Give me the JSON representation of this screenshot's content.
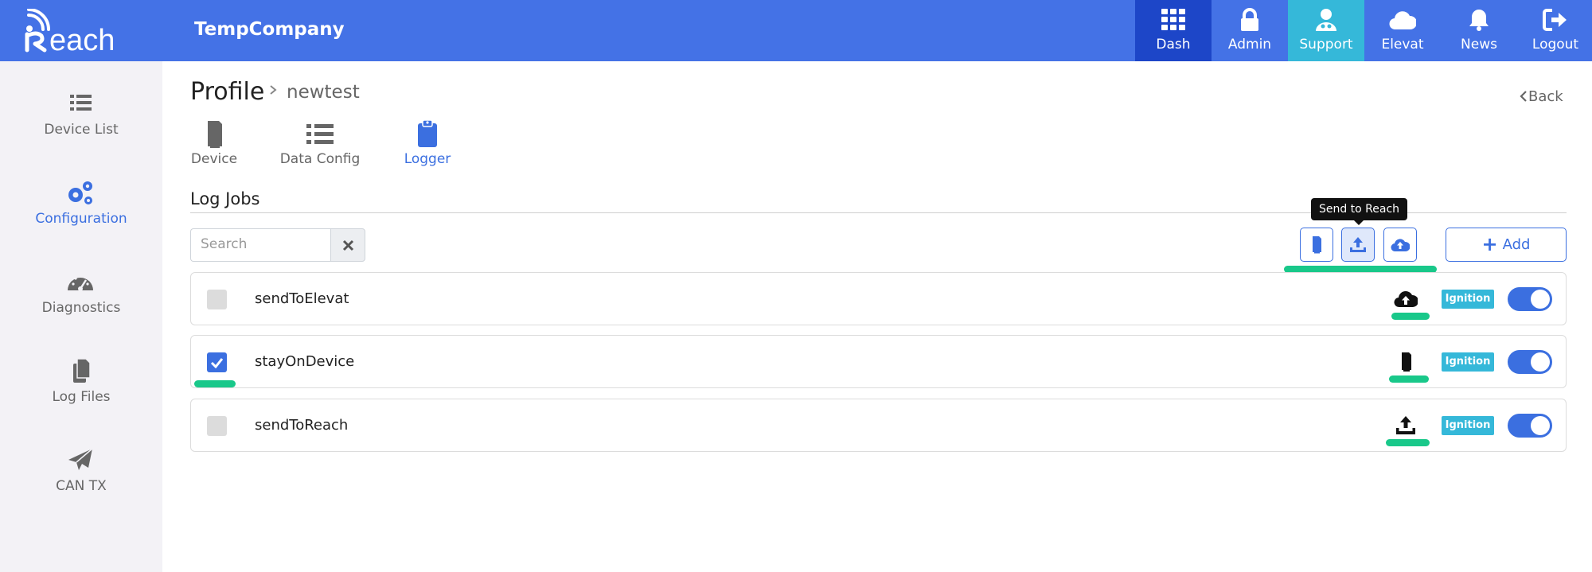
{
  "header": {
    "company": "TempCompany",
    "nav": [
      {
        "label": "Dash",
        "icon": "grid-icon"
      },
      {
        "label": "Admin",
        "icon": "lock-icon"
      },
      {
        "label": "Support",
        "icon": "support-user-icon"
      },
      {
        "label": "Elevat",
        "icon": "cloud-icon"
      },
      {
        "label": "News",
        "icon": "bell-icon"
      },
      {
        "label": "Logout",
        "icon": "logout-icon"
      }
    ],
    "active_color": "#1d46c8",
    "support_color": "#35b8d9",
    "bar_color": "#4472e6"
  },
  "sidebar": {
    "items": [
      {
        "label": "Device List",
        "icon": "list-icon"
      },
      {
        "label": "Configuration",
        "icon": "gears-icon",
        "active": true
      },
      {
        "label": "Diagnostics",
        "icon": "gauge-icon"
      },
      {
        "label": "Log Files",
        "icon": "files-icon"
      },
      {
        "label": "CAN TX",
        "icon": "paper-plane-icon"
      }
    ]
  },
  "breadcrumb": {
    "root": "Profile",
    "current": "newtest",
    "back_label": "Back"
  },
  "tabs": [
    {
      "label": "Device",
      "icon": "device-icon"
    },
    {
      "label": "Data Config",
      "icon": "list-icon"
    },
    {
      "label": "Logger",
      "icon": "clipboard-icon",
      "active": true
    }
  ],
  "log_jobs": {
    "title": "Log Jobs",
    "search_placeholder": "Search",
    "tooltip": "Send to Reach",
    "add_label": "Add",
    "filters": [
      "device-icon",
      "upload-icon",
      "cloud-upload-icon"
    ],
    "rows": [
      {
        "name": "sendToElevat",
        "checked": false,
        "destination_icon": "cloud-upload-icon",
        "badge": "Ignition",
        "enabled": true
      },
      {
        "name": "stayOnDevice",
        "checked": true,
        "destination_icon": "device-icon",
        "badge": "Ignition",
        "enabled": true
      },
      {
        "name": "sendToReach",
        "checked": false,
        "destination_icon": "upload-icon",
        "badge": "Ignition",
        "enabled": true
      }
    ]
  },
  "colors": {
    "accent": "#3b6fe0",
    "highlight": "#19c88a",
    "badge": "#35b8d9"
  }
}
